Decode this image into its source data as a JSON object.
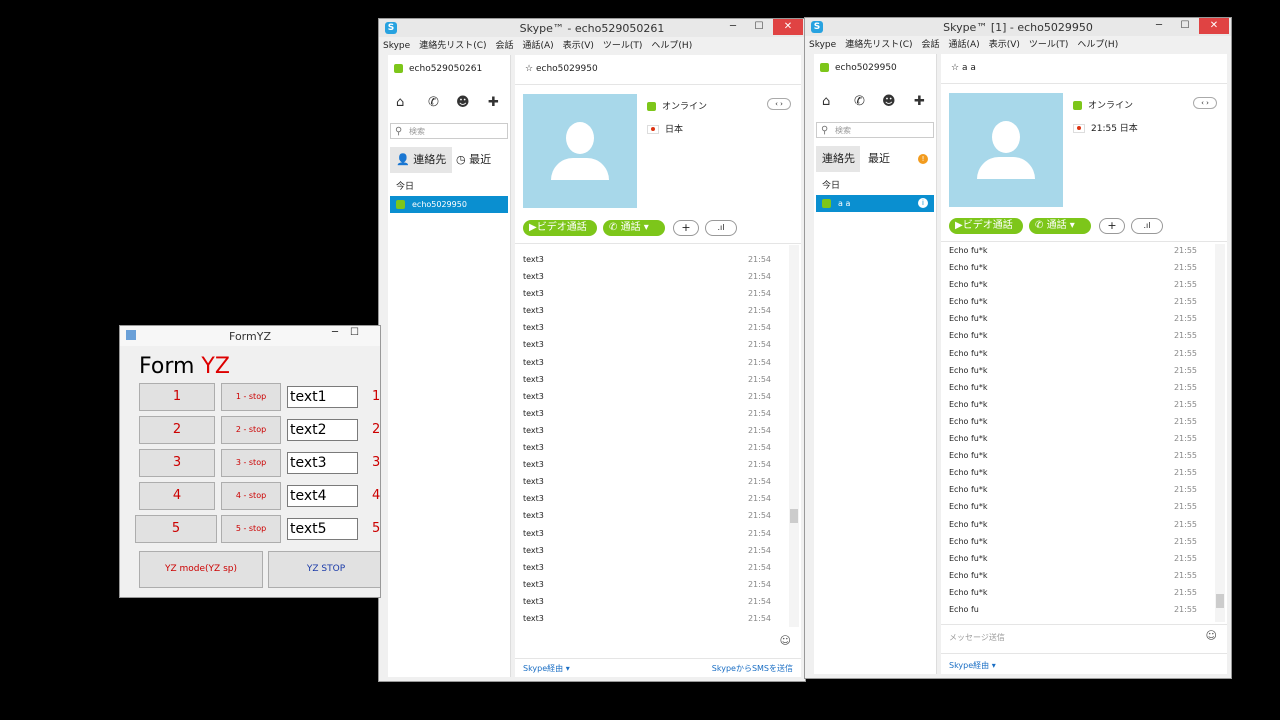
{
  "left_window": {
    "title": "Skype™ - echo529050261",
    "menu": [
      "Skype",
      "連絡先リスト(C)",
      "会話",
      "通話(A)",
      "表示(V)",
      "ツール(T)",
      "ヘルプ(H)"
    ],
    "self_name": "echo529050261",
    "contact_header": "echo5029950",
    "search_placeholder": "検索",
    "tab_contacts": "連絡先",
    "tab_recent": "最近",
    "today": "今日",
    "selected_contact": "echo5029950",
    "status": "オンライン",
    "location": "日本",
    "video_call": "ビデオ通話",
    "call": "通話",
    "messages": [
      {
        "text": "text3",
        "time": "21:54"
      },
      {
        "text": "text3",
        "time": "21:54"
      },
      {
        "text": "text3",
        "time": "21:54"
      },
      {
        "text": "text3",
        "time": "21:54"
      },
      {
        "text": "text3",
        "time": "21:54"
      },
      {
        "text": "text3",
        "time": "21:54"
      },
      {
        "text": "text3",
        "time": "21:54"
      },
      {
        "text": "text3",
        "time": "21:54"
      },
      {
        "text": "text3",
        "time": "21:54"
      },
      {
        "text": "text3",
        "time": "21:54"
      },
      {
        "text": "text3",
        "time": "21:54"
      },
      {
        "text": "text3",
        "time": "21:54"
      },
      {
        "text": "text3",
        "time": "21:54"
      },
      {
        "text": "text3",
        "time": "21:54"
      },
      {
        "text": "text3",
        "time": "21:54"
      },
      {
        "text": "text3",
        "time": "21:54"
      },
      {
        "text": "text3",
        "time": "21:54"
      },
      {
        "text": "text3",
        "time": "21:54"
      },
      {
        "text": "text3",
        "time": "21:54"
      },
      {
        "text": "text3",
        "time": "21:54"
      },
      {
        "text": "text3",
        "time": "21:54"
      },
      {
        "text": "text3",
        "time": "21:54"
      }
    ],
    "footer_left": "Skype経由",
    "footer_right": "SkypeからSMSを送信"
  },
  "right_window": {
    "title": "Skype™ [1] - echo5029950",
    "menu": [
      "Skype",
      "連絡先リスト(C)",
      "会話",
      "通話(A)",
      "表示(V)",
      "ツール(T)",
      "ヘルプ(H)"
    ],
    "self_name": "echo5029950",
    "contact_header": "a a",
    "search_placeholder": "検索",
    "tab_contacts": "連絡先",
    "tab_recent": "最近",
    "today": "今日",
    "selected_contact": "a a",
    "status": "オンライン",
    "location": "21:55 日本",
    "video_call": "ビデオ通話",
    "call": "通話",
    "messages": [
      {
        "text": "Echo fu*k",
        "time": "21:55"
      },
      {
        "text": "Echo fu*k",
        "time": "21:55"
      },
      {
        "text": "Echo fu*k",
        "time": "21:55"
      },
      {
        "text": "Echo fu*k",
        "time": "21:55"
      },
      {
        "text": "Echo fu*k",
        "time": "21:55"
      },
      {
        "text": "Echo fu*k",
        "time": "21:55"
      },
      {
        "text": "Echo fu*k",
        "time": "21:55"
      },
      {
        "text": "Echo fu*k",
        "time": "21:55"
      },
      {
        "text": "Echo fu*k",
        "time": "21:55"
      },
      {
        "text": "Echo fu*k",
        "time": "21:55"
      },
      {
        "text": "Echo fu*k",
        "time": "21:55"
      },
      {
        "text": "Echo fu*k",
        "time": "21:55"
      },
      {
        "text": "Echo fu*k",
        "time": "21:55"
      },
      {
        "text": "Echo fu*k",
        "time": "21:55"
      },
      {
        "text": "Echo fu*k",
        "time": "21:55"
      },
      {
        "text": "Echo fu*k",
        "time": "21:55"
      },
      {
        "text": "Echo fu*k",
        "time": "21:55"
      },
      {
        "text": "Echo fu*k",
        "time": "21:55"
      },
      {
        "text": "Echo fu*k",
        "time": "21:55"
      },
      {
        "text": "Echo fu*k",
        "time": "21:55"
      },
      {
        "text": "Echo fu*k",
        "time": "21:55"
      },
      {
        "text": "Echo fu",
        "time": "21:55"
      }
    ],
    "message_placeholder": "メッセージ送信",
    "footer_left": "Skype経由"
  },
  "form": {
    "title": "FormYZ",
    "heading_black": "Form",
    "heading_red": "YZ",
    "rows": [
      {
        "num": "1",
        "stop": "1 - stop",
        "text": "text1",
        "side": "1"
      },
      {
        "num": "2",
        "stop": "2 - stop",
        "text": "text2",
        "side": "2"
      },
      {
        "num": "3",
        "stop": "3 - stop",
        "text": "text3",
        "side": "3"
      },
      {
        "num": "4",
        "stop": "4 - stop",
        "text": "text4",
        "side": "4"
      },
      {
        "num": "5",
        "stop": "5 - stop",
        "text": "text5",
        "side": "5"
      }
    ],
    "mode_button": "YZ mode(YZ sp)",
    "stop_button": "YZ STOP"
  },
  "colors": {
    "skype_green": "#7dc61a",
    "skype_blue": "#0a8fd0",
    "avatar_bg": "#a8d8ea",
    "close_red": "#e04343"
  }
}
